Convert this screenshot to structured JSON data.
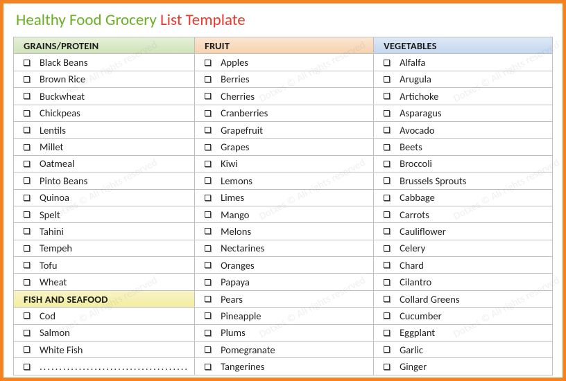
{
  "title": {
    "part1": "Healthy Food Grocery",
    "part2": "List Template"
  },
  "watermark": "Dotxes © All rights reserved",
  "columns": [
    {
      "header": "GRAINS/PROTEIN",
      "headerClass": "hdr-green",
      "items": [
        "Black Beans",
        "Brown Rice",
        "Buckwheat",
        "Chickpeas",
        "Lentils",
        "Millet",
        "Oatmeal",
        "Pinto Beans",
        "Quinoa",
        "Spelt",
        "Tahini",
        "Tempeh",
        "Tofu",
        "Wheat"
      ],
      "subheader": "FISH AND SEAFOOD",
      "subheaderClass": "hdr-yellow",
      "items2": [
        "Cod",
        "Salmon",
        "White Fish"
      ]
    },
    {
      "header": "FRUIT",
      "headerClass": "hdr-orange",
      "items": [
        "Apples",
        "Berries",
        "Cherries",
        "Cranberries",
        "Grapefruit",
        "Grapes",
        "Kiwi",
        "Lemons",
        "Limes",
        "Mango",
        "Melons",
        "Nectarines",
        "Oranges",
        "Papaya",
        "Pears",
        "Pineapple",
        "Plums",
        "Pomegranate",
        "Tangerines"
      ]
    },
    {
      "header": "VEGETABLES",
      "headerClass": "hdr-blue",
      "items": [
        "Alfalfa",
        "Arugula",
        "Artichoke",
        "Asparagus",
        "Avocado",
        "Beets",
        "Broccoli",
        "Brussels Sprouts",
        "Cabbage",
        "Carrots",
        "Cauliflower",
        "Celery",
        "Chard",
        "Cilantro",
        "Collard Greens",
        "Cucumber",
        "Eggplant",
        "Garlic",
        "Ginger"
      ]
    }
  ]
}
